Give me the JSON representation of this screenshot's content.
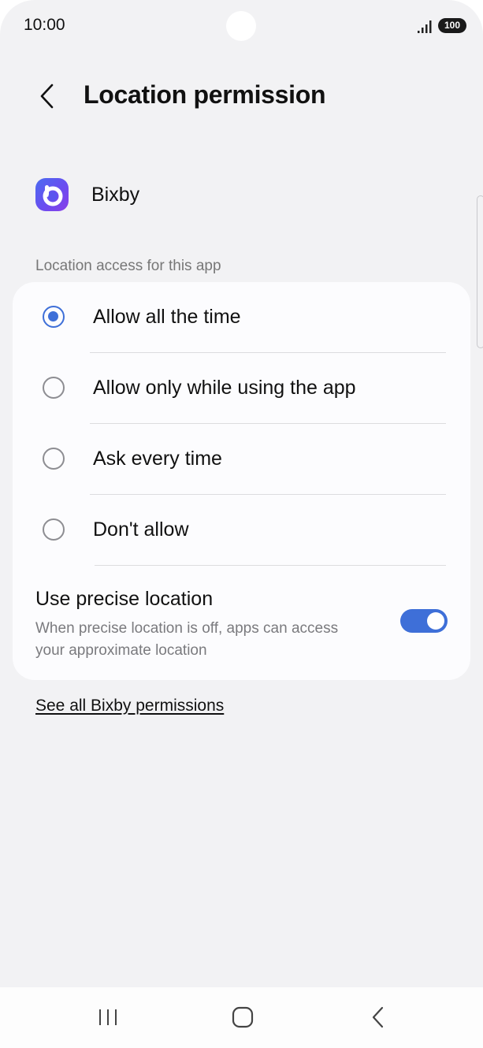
{
  "status_bar": {
    "time": "10:00",
    "battery": "100",
    "signal_icon": "signal-bars-icon"
  },
  "header": {
    "back_icon": "chevron-left-icon",
    "title": "Location permission"
  },
  "app": {
    "name": "Bixby",
    "icon": "bixby-app-icon"
  },
  "section": {
    "label": "Location access for this app"
  },
  "options": [
    {
      "label": "Allow all the time",
      "selected": true
    },
    {
      "label": "Allow only while using the app",
      "selected": false
    },
    {
      "label": "Ask every time",
      "selected": false
    },
    {
      "label": "Don't allow",
      "selected": false
    }
  ],
  "precise_location": {
    "title": "Use precise location",
    "description": "When precise location is off, apps can access your approximate location",
    "enabled": true
  },
  "link": {
    "see_all": "See all Bixby permissions"
  },
  "nav_bar": {
    "recents_icon": "recents-icon",
    "home_icon": "home-icon",
    "back_icon": "back-chevron-icon"
  },
  "colors": {
    "accent": "#3e6fd8",
    "background": "#f2f2f4",
    "card": "#fcfcfe"
  }
}
